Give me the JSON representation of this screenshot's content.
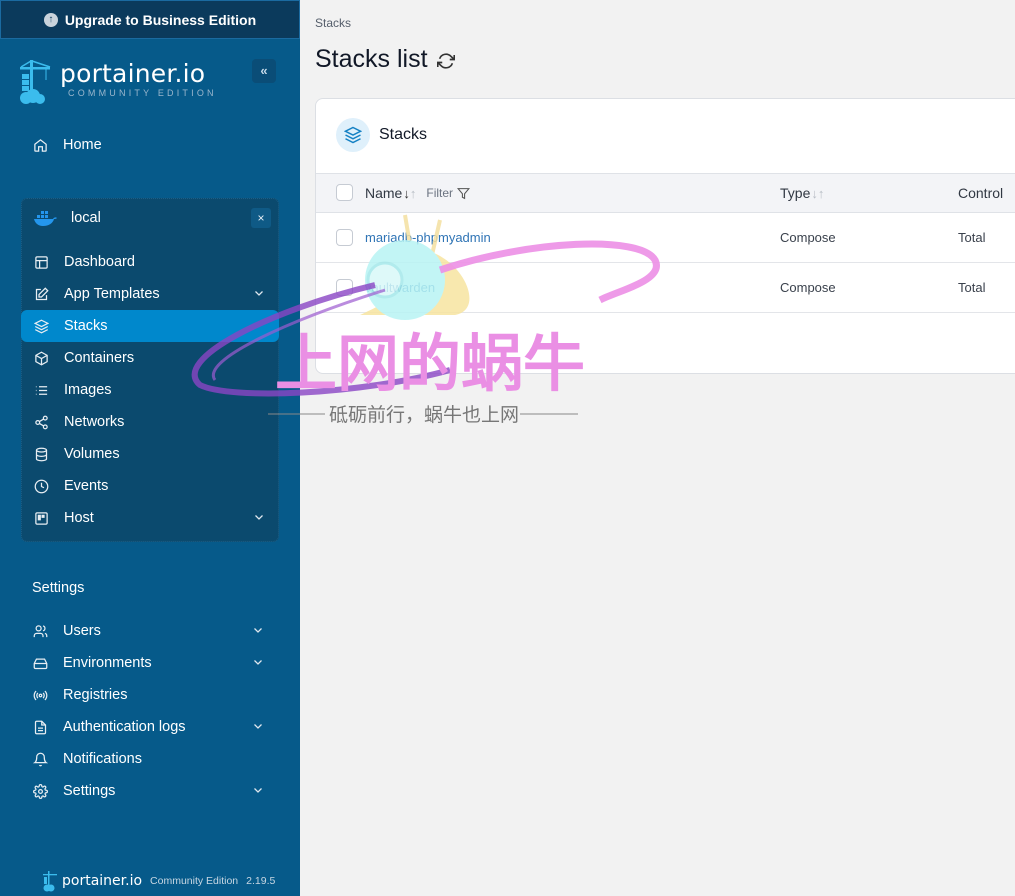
{
  "upgrade_banner": {
    "label": "Upgrade to Business Edition",
    "icon": "arrow-up-circle-icon"
  },
  "logo": {
    "brand": "portainer.io",
    "edition": "COMMUNITY EDITION"
  },
  "sidebar": {
    "collapse_label": "«",
    "home": {
      "label": "Home",
      "icon": "home-icon"
    },
    "environment": {
      "name": "local",
      "icon": "docker-icon",
      "close_label": "×",
      "items": [
        {
          "label": "Dashboard",
          "icon": "dashboard-icon",
          "expandable": false,
          "active": false
        },
        {
          "label": "App Templates",
          "icon": "edit-icon",
          "expandable": true,
          "active": false
        },
        {
          "label": "Stacks",
          "icon": "layers-icon",
          "expandable": false,
          "active": true
        },
        {
          "label": "Containers",
          "icon": "box-icon",
          "expandable": false,
          "active": false
        },
        {
          "label": "Images",
          "icon": "list-icon",
          "expandable": false,
          "active": false
        },
        {
          "label": "Networks",
          "icon": "share-icon",
          "expandable": false,
          "active": false
        },
        {
          "label": "Volumes",
          "icon": "database-icon",
          "expandable": false,
          "active": false
        },
        {
          "label": "Events",
          "icon": "clock-icon",
          "expandable": false,
          "active": false
        },
        {
          "label": "Host",
          "icon": "host-icon",
          "expandable": true,
          "active": false
        }
      ]
    },
    "settings_heading": "Settings",
    "settings_items": [
      {
        "label": "Users",
        "icon": "users-icon",
        "expandable": true
      },
      {
        "label": "Environments",
        "icon": "hard-drive-icon",
        "expandable": true
      },
      {
        "label": "Registries",
        "icon": "radio-icon",
        "expandable": false
      },
      {
        "label": "Authentication logs",
        "icon": "file-text-icon",
        "expandable": true
      },
      {
        "label": "Notifications",
        "icon": "bell-icon",
        "expandable": false
      },
      {
        "label": "Settings",
        "icon": "gear-icon",
        "expandable": true
      }
    ],
    "footer": {
      "brand": "portainer.io",
      "edition": "Community Edition",
      "version": "2.19.5"
    }
  },
  "main": {
    "breadcrumb": "Stacks",
    "title": "Stacks list",
    "card": {
      "title": "Stacks",
      "columns": {
        "name": "Name",
        "filter": "Filter",
        "type": "Type",
        "control": "Control"
      },
      "rows": [
        {
          "name": "mariadb-phpmyadmin",
          "type": "Compose",
          "control": "Total"
        },
        {
          "name": "vaultwarden",
          "type": "Compose",
          "control": "Total"
        }
      ]
    }
  },
  "watermark": {
    "title": "上网的蜗牛",
    "subtitle": "砥砺前行，蜗牛也上网"
  }
}
